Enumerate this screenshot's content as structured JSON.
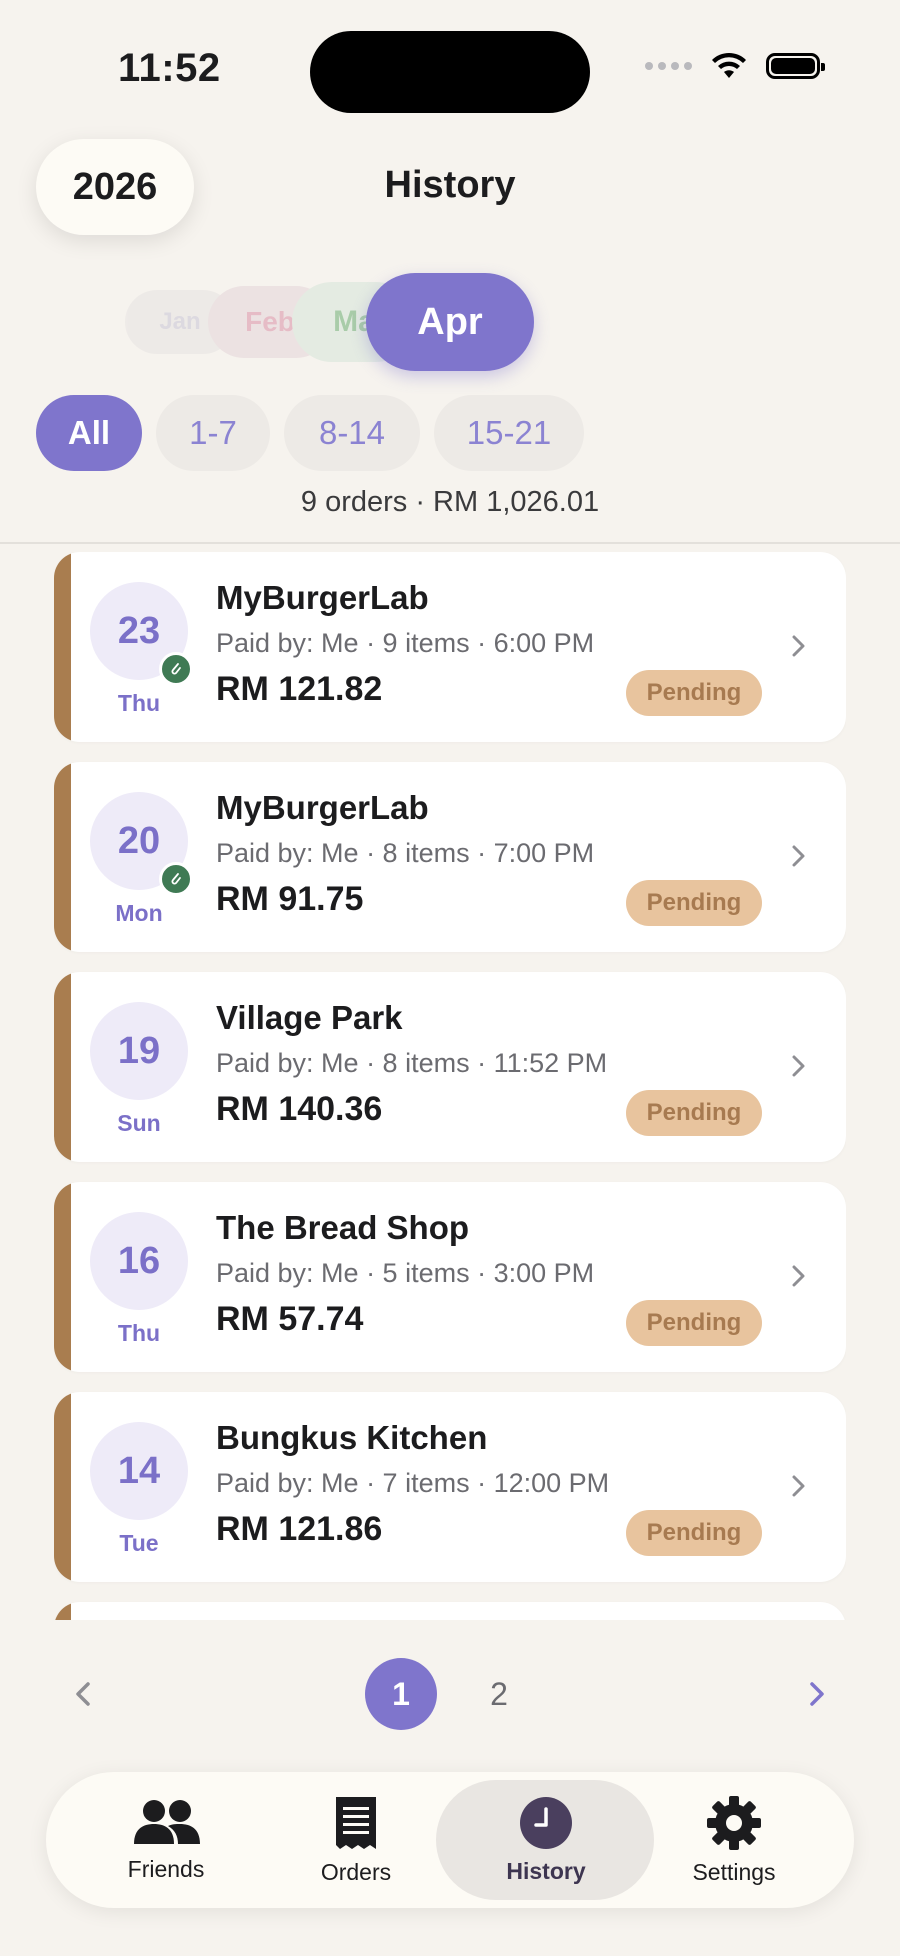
{
  "status_bar": {
    "time": "11:52"
  },
  "header": {
    "year": "2026",
    "title": "History"
  },
  "months": [
    {
      "label": "Jan"
    },
    {
      "label": "Feb"
    },
    {
      "label": "Ma"
    },
    {
      "label": "Apr",
      "selected": true
    }
  ],
  "filters": [
    {
      "label": "All",
      "active": true
    },
    {
      "label": "1-7"
    },
    {
      "label": "8-14"
    },
    {
      "label": "15-21"
    }
  ],
  "summary": "9 orders · RM 1,026.01",
  "orders": [
    {
      "day": "23",
      "weekday": "Thu",
      "store": "MyBurgerLab",
      "meta": "Paid by: Me · 9 items · 6:00 PM",
      "amount": "RM 121.82",
      "status": "Pending",
      "attachment": true
    },
    {
      "day": "20",
      "weekday": "Mon",
      "store": "MyBurgerLab",
      "meta": "Paid by: Me · 8 items · 7:00 PM",
      "amount": "RM 91.75",
      "status": "Pending",
      "attachment": true
    },
    {
      "day": "19",
      "weekday": "Sun",
      "store": "Village Park",
      "meta": "Paid by: Me · 8 items · 11:52 PM",
      "amount": "RM 140.36",
      "status": "Pending",
      "attachment": false
    },
    {
      "day": "16",
      "weekday": "Thu",
      "store": "The Bread Shop",
      "meta": "Paid by: Me · 5 items · 3:00 PM",
      "amount": "RM 57.74",
      "status": "Pending",
      "attachment": false
    },
    {
      "day": "14",
      "weekday": "Tue",
      "store": "Bungkus Kitchen",
      "meta": "Paid by: Me · 7 items · 12:00 PM",
      "amount": "RM 121.86",
      "status": "Pending",
      "attachment": false
    }
  ],
  "pagination": {
    "pages": [
      "1",
      "2"
    ],
    "current": "1"
  },
  "tabs": [
    {
      "label": "Friends",
      "icon": "friends-icon"
    },
    {
      "label": "Orders",
      "icon": "receipt-icon"
    },
    {
      "label": "History",
      "icon": "clock-icon",
      "active": true
    },
    {
      "label": "Settings",
      "icon": "gear-icon"
    }
  ],
  "colors": {
    "accent": "#7f75cc",
    "card_stripe": "#a97d4f",
    "badge_bg": "#e8c49e",
    "badge_text": "#a77a50",
    "background": "#f6f3ee"
  }
}
